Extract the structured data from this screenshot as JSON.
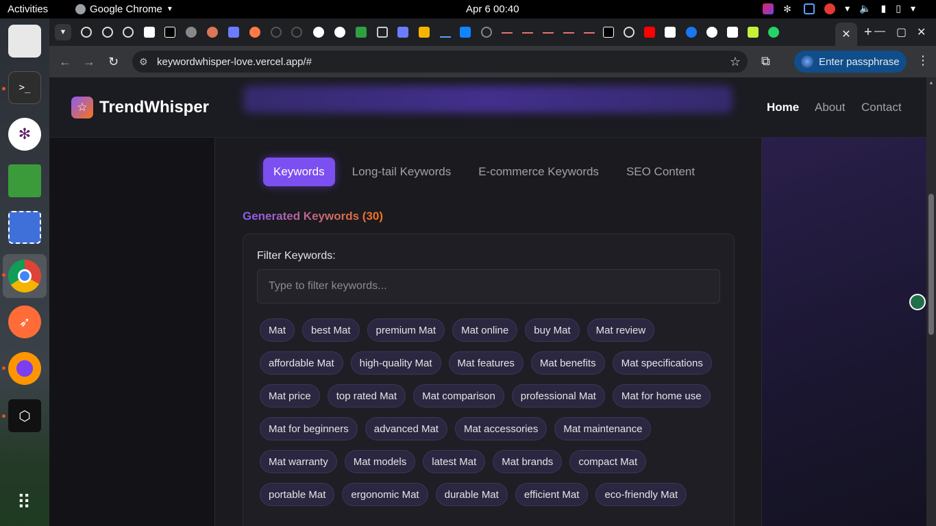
{
  "system": {
    "activities": "Activities",
    "app_name": "Google Chrome",
    "clock": "Apr 6  00:40"
  },
  "browser": {
    "url": "keywordwhisper-love.vercel.app/#",
    "passphrase_button": "Enter passphrase",
    "tab_close": "✕",
    "new_tab": "+"
  },
  "site": {
    "brand": "TrendWhisper",
    "nav": [
      "Home",
      "About",
      "Contact"
    ]
  },
  "tabs": [
    "Keywords",
    "Long-tail Keywords",
    "E-commerce Keywords",
    "SEO Content"
  ],
  "heading": "Generated Keywords (30)",
  "filter": {
    "label": "Filter Keywords:",
    "placeholder": "Type to filter keywords..."
  },
  "keywords": [
    "Mat",
    "best Mat",
    "premium Mat",
    "Mat online",
    "buy Mat",
    "Mat review",
    "affordable Mat",
    "high-quality Mat",
    "Mat features",
    "Mat benefits",
    "Mat specifications",
    "Mat price",
    "top rated Mat",
    "Mat comparison",
    "professional Mat",
    "Mat for home use",
    "Mat for beginners",
    "advanced Mat",
    "Mat accessories",
    "Mat maintenance",
    "Mat warranty",
    "Mat models",
    "latest Mat",
    "Mat brands",
    "compact Mat",
    "portable Mat",
    "ergonomic Mat",
    "durable Mat",
    "efficient Mat",
    "eco-friendly Mat"
  ]
}
